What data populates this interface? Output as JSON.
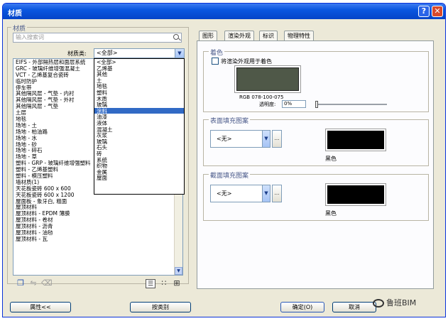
{
  "window": {
    "title": "材质",
    "help_label": "?",
    "close_label": "✕"
  },
  "left": {
    "group_label": "材质",
    "search_placeholder": "输入搜索词",
    "class_label": "材质类:",
    "class_value": "<全部>",
    "materials": [
      "EIFS - 外部隔热层和面层系统",
      "GRC - 玻璃纤维增强混凝土",
      "VCT - 乙烯基复合瓷砖",
      "临时防护",
      "停车带",
      "其他隔风层 - 气垫 - 内衬",
      "其他隔风层 - 气垫 - 外衬",
      "其他隔风层 - 气垫",
      "土层",
      "地毯",
      "场地 - 土",
      "场地 - 柏油路",
      "场地 - 水",
      "场地 - 砂",
      "场地 - 碎石",
      "场地 - 草",
      "塑料 - GRP - 玻璃纤维增强塑料",
      "塑料 - 乙烯基塑料",
      "塑料 - 模压塑料",
      "墙材质(1)",
      "天花板瓷砖 600 x 600",
      "天花板瓷砖 600 x 1200",
      "屋面板 - 象牙白, 粗面",
      "屋顶材料",
      "屋顶材料 - EPDM 薄膜",
      "屋顶材料 - 卷材",
      "屋顶材料 - 沥青",
      "屋顶材料 - 油毡",
      "屋顶材料 - 瓦"
    ],
    "dropdown_items": [
      "<全部>",
      "乙烯基",
      "其他",
      "土",
      "地毯",
      "塑料",
      "木质",
      "玻璃",
      "涂料",
      "油漆",
      "液体",
      "混凝土",
      "灰浆",
      "玻璃",
      "石头",
      "砖",
      "系统",
      "织物",
      "金属",
      "屋面"
    ],
    "dropdown_selected_index": 8,
    "bottom_icons": [
      "duplicate-icon",
      "rename-icon",
      "delete-icon"
    ],
    "view_icons": [
      "list-view-icon",
      "small-icon-view-icon",
      "large-icon-view-icon"
    ],
    "attributes_button": "属性<<",
    "by_class_button": "按类别"
  },
  "tabs": [
    "图形",
    "渲染外观",
    "标识",
    "物理特性"
  ],
  "active_tab_index": 0,
  "shading": {
    "group_label": "着色",
    "use_render_label": "将渲染外观用于着色",
    "use_render_checked": false,
    "rgb_label": "RGB 078-100-075",
    "transparency_label": "透明度:",
    "transparency_value": "0%",
    "transparency_fraction": 0
  },
  "surface_pattern": {
    "group_label": "表面填充图案",
    "pattern_value": "<无>",
    "more_label": "...",
    "color_label": "黑色"
  },
  "cut_pattern": {
    "group_label": "截面填充图案",
    "pattern_value": "<无>",
    "more_label": "...",
    "color_label": "黑色"
  },
  "footer": {
    "ok_button": "确定(O)",
    "cancel_button": "取消"
  },
  "watermark": "鲁班BIM",
  "colors": {
    "shading_color": "#4f5848",
    "pattern_color": "#000000",
    "selection": "#316ac5"
  }
}
